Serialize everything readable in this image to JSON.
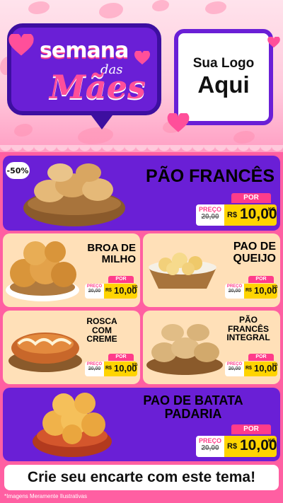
{
  "header": {
    "title_line1": "semana",
    "title_line2": "das",
    "title_line3": "Mães",
    "logo_line1": "Sua Logo",
    "logo_line2": "Aqui"
  },
  "badge": {
    "discount": "-50%"
  },
  "products": [
    {
      "name_lines": [
        "PÃO FRANCÊS"
      ],
      "por": "POR",
      "preco": "PREÇO",
      "old": "20,00",
      "currency": "R$",
      "price": "10,00",
      "unit": "KG"
    },
    {
      "name_lines": [
        "BROA DE",
        "MILHO"
      ],
      "por": "POR",
      "preco": "PREÇO",
      "old": "20,00",
      "currency": "R$",
      "price": "10,00",
      "unit": "KG"
    },
    {
      "name_lines": [
        "PAO DE",
        "QUEIJO"
      ],
      "por": "POR",
      "preco": "PREÇO",
      "old": "20,00",
      "currency": "R$",
      "price": "10,00",
      "unit": "KG"
    },
    {
      "name_lines": [
        "ROSCA",
        "COM",
        "CREME"
      ],
      "por": "POR",
      "preco": "PREÇO",
      "old": "20,00",
      "currency": "R$",
      "price": "10,00",
      "unit": "KG"
    },
    {
      "name_lines": [
        "PÃO",
        "FRANCÊS",
        "INTEGRAL"
      ],
      "por": "POR",
      "preco": "PREÇO",
      "old": "20,00",
      "currency": "R$",
      "price": "10,00",
      "unit": "KG"
    },
    {
      "name_lines": [
        "PAO DE BATATA",
        "PADARIA"
      ],
      "por": "POR",
      "preco": "PREÇO",
      "old": "20,00",
      "currency": "R$",
      "price": "10,00",
      "unit": "KG"
    }
  ],
  "footer": {
    "cta": "Crie seu encarte com este tema!",
    "disclaimer": "*Imagens Meramente Ilustrativas"
  },
  "colors": {
    "purple": "#6a1fd6",
    "pink": "#ff3c8a",
    "cream": "#ffe0b8",
    "yellow": "#ffd400"
  }
}
